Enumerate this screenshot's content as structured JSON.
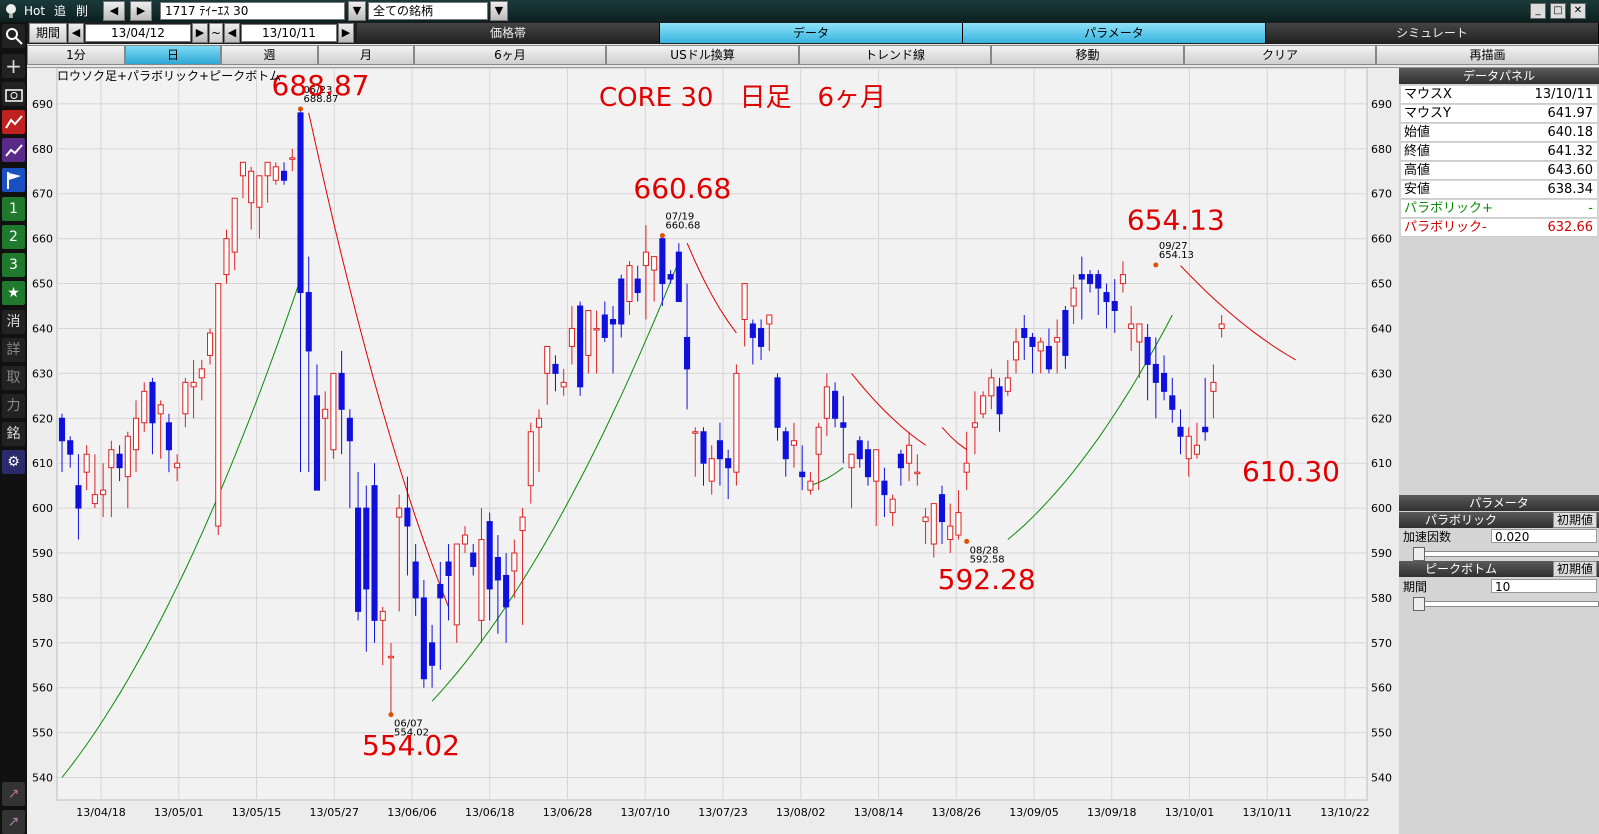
{
  "toolbar": {
    "hot": "Hot",
    "add": "追",
    "del": "削",
    "code": "1717 ﾃｲｰｴｽ 30",
    "filter": "全ての銘柄",
    "period_label": "期間",
    "from_date": "13/04/12",
    "tilde": "~",
    "to_date": "13/10/11",
    "tabs": [
      "価格帯",
      "データ",
      "パラメータ",
      "シミュレート"
    ],
    "row3": [
      "1分",
      "日",
      "週",
      "月",
      "6ヶ月",
      "USドル換算",
      "トレンド線",
      "移動",
      "クリア",
      "再描画"
    ],
    "row3_selected": "日"
  },
  "left_toolbar": {
    "text_buttons": [
      "1",
      "2",
      "3",
      "消",
      "詳",
      "取",
      "力",
      "銘"
    ],
    "icons": [
      "lightbulb-icon",
      "magnify-icon",
      "crosshair-icon",
      "camera-icon",
      "chart-icon",
      "chart2-icon",
      "flag-icon",
      "star-icon",
      "gear-icon"
    ]
  },
  "data_panel": {
    "title": "データパネル",
    "rows": [
      {
        "label": "マウスX",
        "value": "13/10/11"
      },
      {
        "label": "マウスY",
        "value": "641.97"
      },
      {
        "label": "始値",
        "value": "640.18"
      },
      {
        "label": "終値",
        "value": "641.32"
      },
      {
        "label": "高値",
        "value": "643.60"
      },
      {
        "label": "安値",
        "value": "638.34"
      },
      {
        "label": "パラボリック+",
        "value": "-"
      },
      {
        "label": "パラボリック-",
        "value": "632.66"
      }
    ]
  },
  "param_panel": {
    "title": "パラメータ",
    "parabolic": "パラボリック",
    "init": "初期値",
    "accel_label": "加速因数",
    "accel_value": "0.020",
    "peak": "ピークボトム",
    "period_label": "期間",
    "period_value": "10"
  },
  "chart_data": {
    "type": "candlestick",
    "title": "CORE 30　日足　6ヶ月",
    "subtitle": "ロウソク足+パラボリック+ピークボトム",
    "ylim": [
      535,
      698
    ],
    "yticks": [
      540,
      550,
      560,
      570,
      580,
      590,
      600,
      610,
      620,
      630,
      640,
      650,
      660,
      670,
      680,
      690
    ],
    "xticks": [
      "13/04/18",
      "13/05/01",
      "13/05/15",
      "13/05/27",
      "13/06/06",
      "13/06/18",
      "13/06/28",
      "13/07/10",
      "13/07/23",
      "13/08/02",
      "13/08/14",
      "13/08/26",
      "13/09/05",
      "13/09/18",
      "13/10/01",
      "13/10/11",
      "13/10/22"
    ],
    "up_color": "#dd2222",
    "down_color": "#1010dd",
    "candles": [
      [
        620,
        621,
        608,
        615
      ],
      [
        615,
        616,
        609,
        612
      ],
      [
        605,
        612,
        593,
        600
      ],
      [
        608,
        614,
        604,
        612
      ],
      [
        601,
        612,
        600,
        603
      ],
      [
        603,
        610,
        598,
        604
      ],
      [
        609,
        615,
        598,
        613
      ],
      [
        612,
        614,
        606,
        609
      ],
      [
        607,
        617,
        600,
        616
      ],
      [
        613,
        624,
        608,
        620
      ],
      [
        619,
        628,
        617,
        626
      ],
      [
        628,
        629,
        612,
        619
      ],
      [
        621,
        624,
        611,
        623
      ],
      [
        619,
        621,
        608,
        613
      ],
      [
        609,
        612,
        606,
        610
      ],
      [
        621,
        629,
        618,
        628
      ],
      [
        627,
        633,
        620,
        628
      ],
      [
        629,
        633,
        624,
        631
      ],
      [
        634,
        640,
        632,
        639
      ],
      [
        596,
        628,
        594,
        650
      ],
      [
        652,
        662,
        650,
        660
      ],
      [
        657,
        666,
        653,
        669
      ],
      [
        674,
        677,
        669,
        677
      ],
      [
        668,
        676,
        662,
        675
      ],
      [
        667,
        671,
        660,
        674
      ],
      [
        674,
        677,
        668,
        677
      ],
      [
        673,
        677,
        672,
        676
      ],
      [
        675,
        677,
        672,
        673
      ],
      [
        678,
        680,
        675,
        678
      ],
      [
        688,
        689,
        608,
        648
      ],
      [
        648,
        656,
        608,
        635
      ],
      [
        625,
        632,
        613,
        604
      ],
      [
        620,
        626,
        606,
        622
      ],
      [
        613,
        630,
        611,
        630
      ],
      [
        630,
        635,
        612,
        622
      ],
      [
        620,
        622,
        600,
        615
      ],
      [
        600,
        608,
        575,
        577
      ],
      [
        600,
        605,
        568,
        582
      ],
      [
        605,
        610,
        570,
        575
      ],
      [
        575,
        578,
        565,
        577
      ],
      [
        567,
        570,
        554,
        567
      ],
      [
        598,
        603,
        577,
        600
      ],
      [
        600,
        607,
        585,
        596
      ],
      [
        588,
        592,
        576,
        580
      ],
      [
        580,
        584,
        560,
        562
      ],
      [
        570,
        574,
        560,
        565
      ],
      [
        583,
        588,
        564,
        580
      ],
      [
        588,
        592,
        575,
        585
      ],
      [
        574,
        585,
        570,
        592
      ],
      [
        592,
        596,
        590,
        594
      ],
      [
        590,
        592,
        585,
        587
      ],
      [
        575,
        600,
        570,
        593
      ],
      [
        597,
        599,
        575,
        582
      ],
      [
        589,
        594,
        572,
        584
      ],
      [
        585,
        590,
        570,
        578
      ],
      [
        586,
        593,
        580,
        590
      ],
      [
        595,
        600,
        574,
        598
      ],
      [
        605,
        619,
        601,
        617
      ],
      [
        618,
        622,
        608,
        620
      ],
      [
        630,
        633,
        623,
        636
      ],
      [
        632,
        634,
        626,
        630
      ],
      [
        627,
        631,
        625,
        628
      ],
      [
        636,
        645,
        632,
        640
      ],
      [
        645,
        646,
        625,
        627
      ],
      [
        634,
        640,
        630,
        644
      ],
      [
        640,
        644,
        630,
        640
      ],
      [
        643,
        646,
        637,
        638
      ],
      [
        642,
        645,
        630,
        641
      ],
      [
        651,
        652,
        638,
        641
      ],
      [
        646,
        655,
        643,
        654
      ],
      [
        651,
        654,
        646,
        648
      ],
      [
        654,
        663,
        642,
        657
      ],
      [
        653,
        656,
        646,
        656
      ],
      [
        660,
        661,
        645,
        650
      ],
      [
        652,
        653,
        650,
        651
      ],
      [
        657,
        659,
        652,
        646
      ],
      [
        638,
        650,
        622,
        631
      ],
      [
        617,
        618,
        607,
        617
      ],
      [
        617,
        618,
        605,
        610
      ],
      [
        606,
        614,
        603,
        611
      ],
      [
        615,
        619,
        605,
        611
      ],
      [
        611,
        613,
        602,
        609
      ],
      [
        608,
        632,
        605,
        630
      ],
      [
        642,
        648,
        636,
        650
      ],
      [
        641,
        642,
        632,
        638
      ],
      [
        640,
        642,
        633,
        636
      ],
      [
        641,
        642,
        635,
        643
      ],
      [
        629,
        630,
        615,
        618
      ],
      [
        617,
        618,
        607,
        611
      ],
      [
        614,
        619,
        609,
        615
      ],
      [
        608,
        614,
        604,
        607
      ],
      [
        604,
        608,
        603,
        606
      ],
      [
        612,
        619,
        604,
        618
      ],
      [
        620,
        630,
        616,
        627
      ],
      [
        626,
        628,
        618,
        620
      ],
      [
        619,
        625,
        610,
        618
      ],
      [
        609,
        612,
        600,
        612
      ],
      [
        615,
        616,
        609,
        611
      ],
      [
        613,
        615,
        605,
        607
      ],
      [
        606,
        612,
        596,
        613
      ],
      [
        606,
        609,
        598,
        603
      ],
      [
        599,
        603,
        596,
        602
      ],
      [
        612,
        613,
        605,
        609
      ],
      [
        610,
        617,
        606,
        614
      ],
      [
        608,
        612,
        605,
        608
      ],
      [
        597,
        600,
        592,
        598
      ],
      [
        592,
        597,
        589,
        601
      ],
      [
        603,
        605,
        592,
        597
      ],
      [
        593,
        601,
        590,
        596
      ],
      [
        594,
        604,
        593,
        599
      ],
      [
        608,
        617,
        604,
        610
      ],
      [
        618,
        626,
        612,
        619
      ],
      [
        621,
        626,
        620,
        625
      ],
      [
        625,
        631,
        622,
        629
      ],
      [
        627,
        629,
        617,
        621
      ],
      [
        626,
        633,
        625,
        629
      ],
      [
        633,
        640,
        630,
        637
      ],
      [
        640,
        643,
        633,
        638
      ],
      [
        638,
        639,
        630,
        636
      ],
      [
        635,
        638,
        630,
        637
      ],
      [
        636,
        640,
        630,
        631
      ],
      [
        637,
        642,
        630,
        638
      ],
      [
        644,
        645,
        631,
        634
      ],
      [
        645,
        652,
        641,
        649
      ],
      [
        652,
        656,
        642,
        651
      ],
      [
        652,
        653,
        648,
        650
      ],
      [
        652,
        653,
        643,
        649
      ],
      [
        648,
        650,
        640,
        646
      ],
      [
        646,
        651,
        639,
        644
      ],
      [
        650,
        655,
        648,
        652
      ],
      [
        640,
        645,
        635,
        641
      ],
      [
        637,
        640,
        629,
        641
      ],
      [
        638,
        641,
        624,
        632
      ],
      [
        632,
        638,
        620,
        628
      ],
      [
        630,
        634,
        624,
        626
      ],
      [
        625,
        629,
        619,
        622
      ],
      [
        618,
        622,
        612,
        616
      ],
      [
        611,
        618,
        607,
        616
      ],
      [
        612,
        619,
        611,
        614
      ],
      [
        618,
        629,
        615,
        617
      ],
      [
        626,
        632,
        620,
        628
      ],
      [
        640,
        643,
        638,
        641
      ]
    ],
    "parabolic_plus": [
      {
        "from": 0,
        "to": 29,
        "start": 540,
        "end": 651
      },
      {
        "from": 45,
        "to": 75,
        "start": 557,
        "end": 655
      },
      {
        "from": 91,
        "to": 95,
        "start": 605,
        "end": 609
      },
      {
        "from": 115,
        "to": 135,
        "start": 593,
        "end": 643
      }
    ],
    "parabolic_minus": [
      {
        "from": 30,
        "to": 47,
        "start": 688,
        "end": 578
      },
      {
        "from": 76,
        "to": 82,
        "start": 659,
        "end": 639
      },
      {
        "from": 96,
        "to": 105,
        "start": 630,
        "end": 614
      },
      {
        "from": 107,
        "to": 110,
        "start": 618,
        "end": 613
      },
      {
        "from": 136,
        "to": 150,
        "start": 654,
        "end": 633
      }
    ],
    "peaks": [
      {
        "date": "05/23",
        "value": "688.87",
        "idx": 29,
        "price": 688.87,
        "type": "high"
      },
      {
        "date": "06/07",
        "value": "554.02",
        "idx": 40,
        "price": 554.02,
        "type": "low"
      },
      {
        "date": "07/19",
        "value": "660.68",
        "idx": 73,
        "price": 660.68,
        "type": "high"
      },
      {
        "date": "08/28",
        "value": "592.58",
        "idx": 110,
        "price": 592.58,
        "type": "low"
      },
      {
        "date": "09/27",
        "value": "654.13",
        "idx": 133,
        "price": 654.13,
        "type": "high"
      }
    ],
    "annotations": [
      {
        "text": "688.87",
        "idx": 29,
        "price": 692
      },
      {
        "text": "554.02",
        "idx": 40,
        "price": 545
      },
      {
        "text": "660.68",
        "idx": 73,
        "price": 669
      },
      {
        "text": "592.28",
        "idx": 110,
        "price": 582
      },
      {
        "text": "654.13",
        "idx": 133,
        "price": 662
      },
      {
        "text": "610.30",
        "idx": 147,
        "price": 606
      }
    ]
  }
}
